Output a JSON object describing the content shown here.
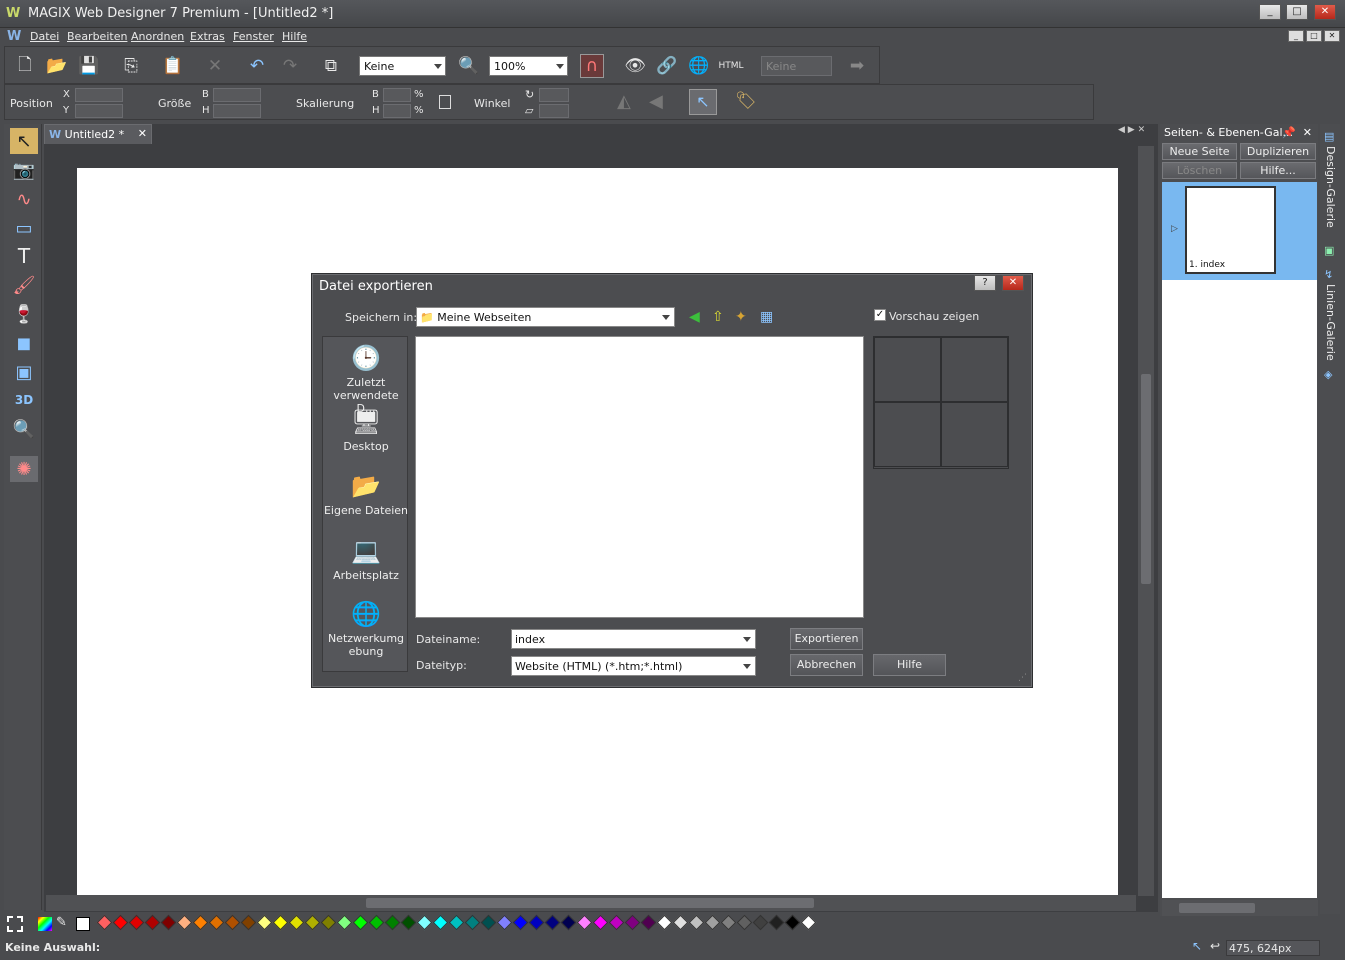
{
  "window": {
    "title": "MAGIX Web Designer 7 Premium - [Untitled2 *]",
    "logo": "W",
    "controls": [
      "_",
      "□",
      "✕"
    ]
  },
  "menu": {
    "items": [
      "Datei",
      "Bearbeiten",
      "Anordnen",
      "Extras",
      "Fenster",
      "Hilfe"
    ]
  },
  "toolbar": {
    "quality_combo": "Keine",
    "zoom_combo": "100%",
    "html_label": "HTML",
    "link_combo": "Keine"
  },
  "infobar": {
    "position_label": "Position",
    "x_label": "X",
    "y_label": "Y",
    "size_label": "Größe",
    "b_label": "B",
    "h_label": "H",
    "scale_label": "Skalierung",
    "scale_b": "B",
    "scale_h": "H",
    "percent": "%",
    "angle_label": "Winkel"
  },
  "document": {
    "tab_label": "Untitled2 *"
  },
  "gallery": {
    "title": "Seiten- & Ebenen-Gal...",
    "new_page": "Neue Seite",
    "duplicate": "Duplizieren",
    "delete": "Löschen",
    "help": "Hilfe...",
    "page_label": "1. index"
  },
  "sidetabs": {
    "design": "Design-Galerie",
    "lines": "Linien-Galerie"
  },
  "dialog": {
    "title": "Datei exportieren",
    "help_btn": "?",
    "close_btn": "✕",
    "save_in_label": "Speichern in:",
    "save_in_value": "Meine Webseiten",
    "preview_label": "Vorschau zeigen",
    "preview_checked": true,
    "places": [
      {
        "label": "Zuletzt verwendete D...",
        "icon": "recent-icon"
      },
      {
        "label": "Desktop",
        "icon": "desktop-icon"
      },
      {
        "label": "Eigene Dateien",
        "icon": "documents-folder-icon"
      },
      {
        "label": "Arbeitsplatz",
        "icon": "computer-icon"
      },
      {
        "label": "Netzwerkumgebung",
        "icon": "network-icon"
      }
    ],
    "filename_label": "Dateiname:",
    "filename_value": "index",
    "filetype_label": "Dateityp:",
    "filetype_value": "Website (HTML) (*.htm;*.html)",
    "export_btn": "Exportieren",
    "cancel_btn": "Abbrechen",
    "help_button": "Hilfe"
  },
  "status": {
    "selection": "Keine Auswahl:",
    "coords": "475, 624px"
  },
  "palette_colors": [
    "#ff6060",
    "#ff0000",
    "#e00000",
    "#b00000",
    "#800000",
    "#ffb080",
    "#ff8000",
    "#e07000",
    "#b05000",
    "#804000",
    "#ffff80",
    "#ffff00",
    "#e0e000",
    "#b0b000",
    "#808000",
    "#80ff80",
    "#00ff00",
    "#00c000",
    "#008000",
    "#005000",
    "#80ffff",
    "#00ffff",
    "#00c0c0",
    "#008080",
    "#005050",
    "#8080ff",
    "#0000ff",
    "#0000c0",
    "#000080",
    "#000050",
    "#ff80ff",
    "#ff00ff",
    "#c000c0",
    "#800080",
    "#500050",
    "#ffffff",
    "#e0e0e0",
    "#c0c0c0",
    "#a0a0a0",
    "#808080",
    "#606060",
    "#404040",
    "#202020",
    "#000000",
    "#ffffff"
  ]
}
